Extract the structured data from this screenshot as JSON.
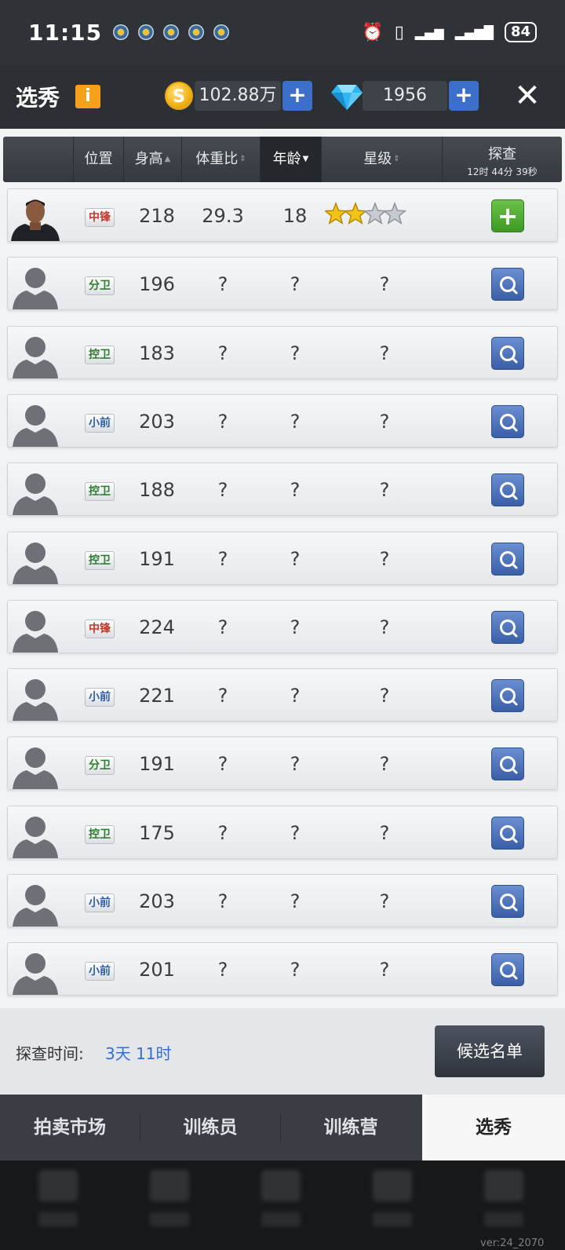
{
  "status_bar": {
    "time": "11:15",
    "battery": "84"
  },
  "header": {
    "title": "选秀",
    "info_icon": "i",
    "coin_symbol": "S",
    "coins": "102.88万",
    "diamonds": "1956",
    "plus": "+",
    "close": "✕"
  },
  "columns": {
    "position": "位置",
    "height": "身高",
    "weight_ratio": "体重比",
    "age": "年龄",
    "stars": "星级",
    "scout": "探查",
    "scout_timer": "12时 44分 39秒"
  },
  "players": [
    {
      "position": "中锋",
      "pos_class": "pos-center",
      "height": "218",
      "ratio": "29.3",
      "age": "18",
      "star": "",
      "stars_filled": 2,
      "revealed": true
    },
    {
      "position": "分卫",
      "pos_class": "pos-sg",
      "height": "196",
      "ratio": "?",
      "age": "?",
      "star": "?",
      "revealed": false
    },
    {
      "position": "控卫",
      "pos_class": "pos-pg",
      "height": "183",
      "ratio": "?",
      "age": "?",
      "star": "?",
      "revealed": false
    },
    {
      "position": "小前",
      "pos_class": "pos-sf",
      "height": "203",
      "ratio": "?",
      "age": "?",
      "star": "?",
      "revealed": false
    },
    {
      "position": "控卫",
      "pos_class": "pos-pg",
      "height": "188",
      "ratio": "?",
      "age": "?",
      "star": "?",
      "revealed": false
    },
    {
      "position": "控卫",
      "pos_class": "pos-pg",
      "height": "191",
      "ratio": "?",
      "age": "?",
      "star": "?",
      "revealed": false
    },
    {
      "position": "中锋",
      "pos_class": "pos-center",
      "height": "224",
      "ratio": "?",
      "age": "?",
      "star": "?",
      "revealed": false
    },
    {
      "position": "小前",
      "pos_class": "pos-sf",
      "height": "221",
      "ratio": "?",
      "age": "?",
      "star": "?",
      "revealed": false
    },
    {
      "position": "分卫",
      "pos_class": "pos-sg",
      "height": "191",
      "ratio": "?",
      "age": "?",
      "star": "?",
      "revealed": false
    },
    {
      "position": "控卫",
      "pos_class": "pos-pg",
      "height": "175",
      "ratio": "?",
      "age": "?",
      "star": "?",
      "revealed": false
    },
    {
      "position": "小前",
      "pos_class": "pos-sf",
      "height": "203",
      "ratio": "?",
      "age": "?",
      "star": "?",
      "revealed": false
    },
    {
      "position": "小前",
      "pos_class": "pos-sf",
      "height": "201",
      "ratio": "?",
      "age": "?",
      "star": "?",
      "revealed": false
    }
  ],
  "footer": {
    "scout_time_label": "探查时间:",
    "scout_time_value": "3天 11时",
    "shortlist_button": "候选名单"
  },
  "tabs": [
    "拍卖市场",
    "训练员",
    "训练营",
    "选秀"
  ],
  "active_tab": 3,
  "version": "ver:24_2070",
  "colors": {
    "accent_blue": "#3c6fc9",
    "add_green": "#3d9a23",
    "header_bg": "#2c3035"
  }
}
